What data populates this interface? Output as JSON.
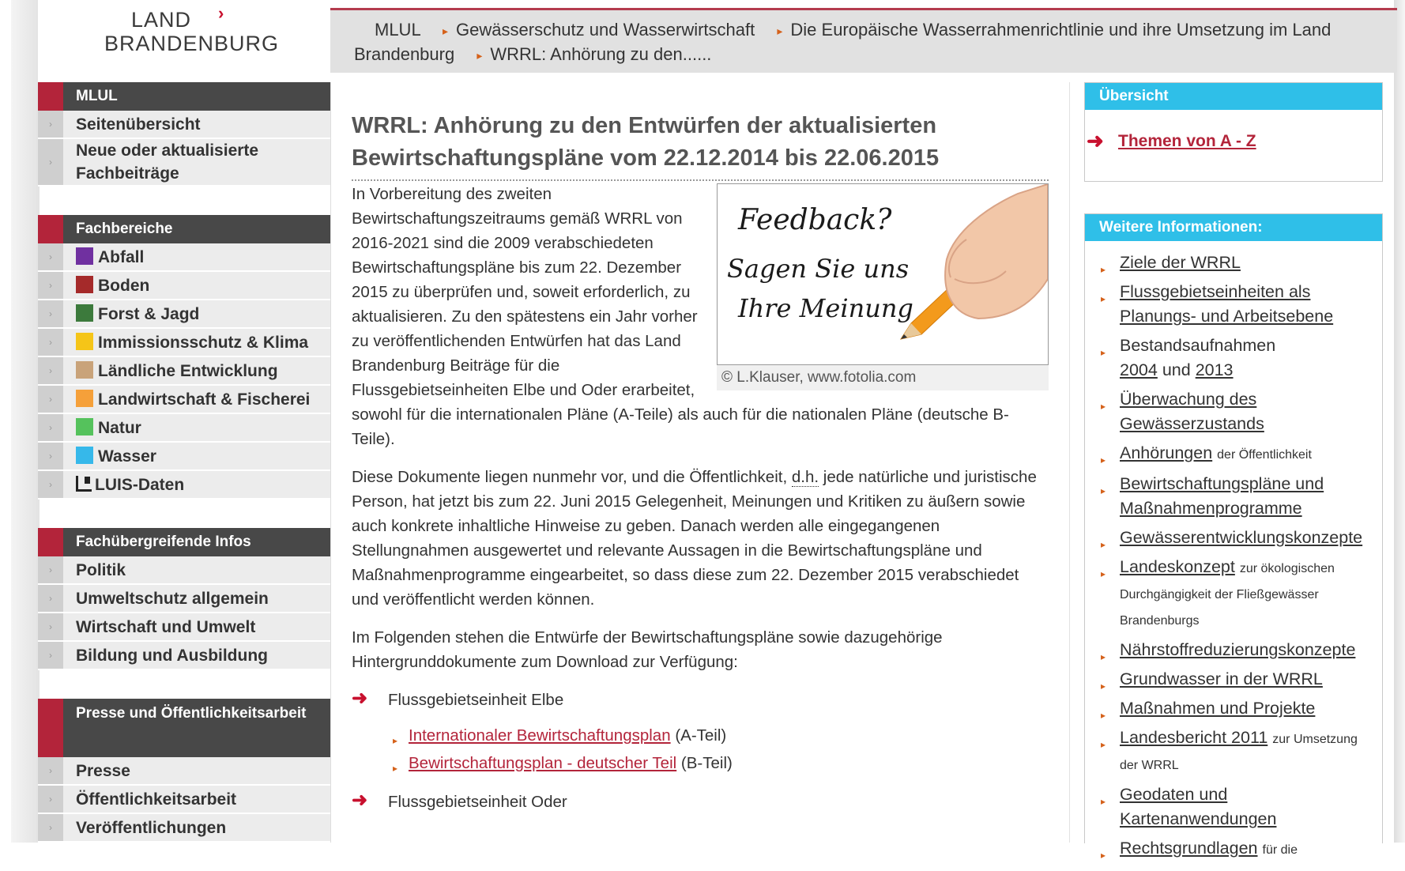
{
  "logo": {
    "line1": "LAND",
    "line2": "BRANDENBURG"
  },
  "breadcrumb": [
    "MLUL",
    "Gewässerschutz und Wasserwirtschaft",
    "Die Europäische Wasserrahmenrichtlinie und ihre Umsetzung im Land Brandenburg",
    "WRRL: Anhörung zu den......"
  ],
  "sidebar": {
    "s1": {
      "head": "MLUL",
      "items": [
        "Seitenübersicht",
        "Neue oder aktualisierte Fachbeiträge"
      ]
    },
    "s2": {
      "head": "Fachbereiche",
      "items": [
        {
          "label": "Abfall",
          "color": "#7030a0"
        },
        {
          "label": "Boden",
          "color": "#a52a2a"
        },
        {
          "label": "Forst & Jagd",
          "color": "#3c7a3c"
        },
        {
          "label": "Immissionsschutz & Klima",
          "color": "#f5c518"
        },
        {
          "label": "Ländliche Entwicklung",
          "color": "#c9a37a"
        },
        {
          "label": "Landwirtschaft & Fischerei",
          "color": "#f5a03a"
        },
        {
          "label": "Natur",
          "color": "#55c25c"
        },
        {
          "label": "Wasser",
          "color": "#36b8ea"
        },
        {
          "label": "LUIS-Daten",
          "color": "#222222"
        }
      ]
    },
    "s3": {
      "head": "Fachübergreifende Infos",
      "items": [
        "Politik",
        "Umweltschutz allgemein",
        "Wirtschaft und Umwelt",
        "Bildung und Ausbildung"
      ]
    },
    "s4": {
      "head": "Presse und Öffentlichkeitsarbeit",
      "items": [
        "Presse",
        "Öffentlichkeitsarbeit",
        "Veröffentlichungen"
      ]
    }
  },
  "main": {
    "title": "WRRL: Anhörung zu den Entwürfen der aktualisierten Bewirtschaftungspläne vom 22.12.2014 bis 22.06.2015",
    "figure": {
      "line1": "Feedback?",
      "line2": "Sagen Sie uns",
      "line3": "Ihre Meinung",
      "caption": "© L.Klauser, www.fotolia.com"
    },
    "p1": "In Vorbereitung des zweiten Bewirtschaftungszeitraums gemäß WRRL von 2016-2021 sind die 2009 verabschiedeten Bewirtschaftungspläne bis zum 22. Dezember 2015 zu überprüfen und, soweit erforderlich, zu aktualisieren. Zu den spätestens ein Jahr vorher zu veröffentlichenden Entwürfen hat das Land Brandenburg Beiträge für die Flussgebietseinheiten Elbe und Oder erarbeitet, sowohl für die internationalen Pläne (A-Teile) als auch für die nationalen Pläne (deutsche B-Teile).",
    "p2a": "Diese Dokumente liegen nunmehr vor, und die Öffentlichkeit,",
    "p2abbr": "d.h.",
    "p2b": "jede natürliche und juristische Person, hat jetzt bis zum 22. Juni 2015 Gelegenheit, Meinungen und Kritiken zu äußern sowie auch konkrete inhaltliche Hinweise zu geben. Danach werden alle eingegangenen Stellungnahmen ausgewertet und relevante Aussagen in die Bewirtschaftungspläne und Maßnahmenprogramme eingearbeitet, so dass diese zum 22. Dezember 2015 verabschiedet und veröffentlicht werden können.",
    "p3": "Im Folgenden stehen die Entwürfe der Bewirtschaftungspläne sowie dazugehörige Hintergrunddokumente zum Download zur Verfügung:",
    "elbe": {
      "label": "Flussgebietseinheit Elbe",
      "link1": "Internationaler Bewirtschaftungsplan",
      "suffix1": "(A-Teil)",
      "link2": "Bewirtschaftungsplan - deutscher Teil",
      "suffix2": "(B-Teil)"
    },
    "oder": {
      "label": "Flussgebietseinheit Oder"
    }
  },
  "right": {
    "box1": {
      "head": "Übersicht",
      "link": "Themen von A - Z"
    },
    "box2": {
      "head": "Weitere Informationen:",
      "i1": "Ziele der WRRL",
      "i2": "Flussgebietseinheiten als Planungs- und Arbeitsebene",
      "i3a": "Bestandsaufnahmen",
      "i3b": "2004",
      "i3c": "und",
      "i3d": "2013",
      "i4": "Überwachung des Gewässerzustands",
      "i5a": "Anhörungen",
      "i5b": "der Öffentlichkeit",
      "i6": "Bewirtschaftungspläne und Maßnahmenprogramme",
      "i7": "Gewässerentwicklungskonzepte",
      "i8a": "Landeskonzept",
      "i8b": "zur ökologischen Durchgängigkeit der Fließgewässer Brandenburgs",
      "i9": "Nährstoffreduzierungskonzepte",
      "i10": "Grundwasser in der WRRL",
      "i11": "Maßnahmen und Projekte",
      "i12a": "Landesbericht 2011",
      "i12b": "zur Umsetzung der WRRL",
      "i13": "Geodaten und Kartenanwendungen",
      "i14a": "Rechtsgrundlagen",
      "i14b": "für die"
    }
  }
}
